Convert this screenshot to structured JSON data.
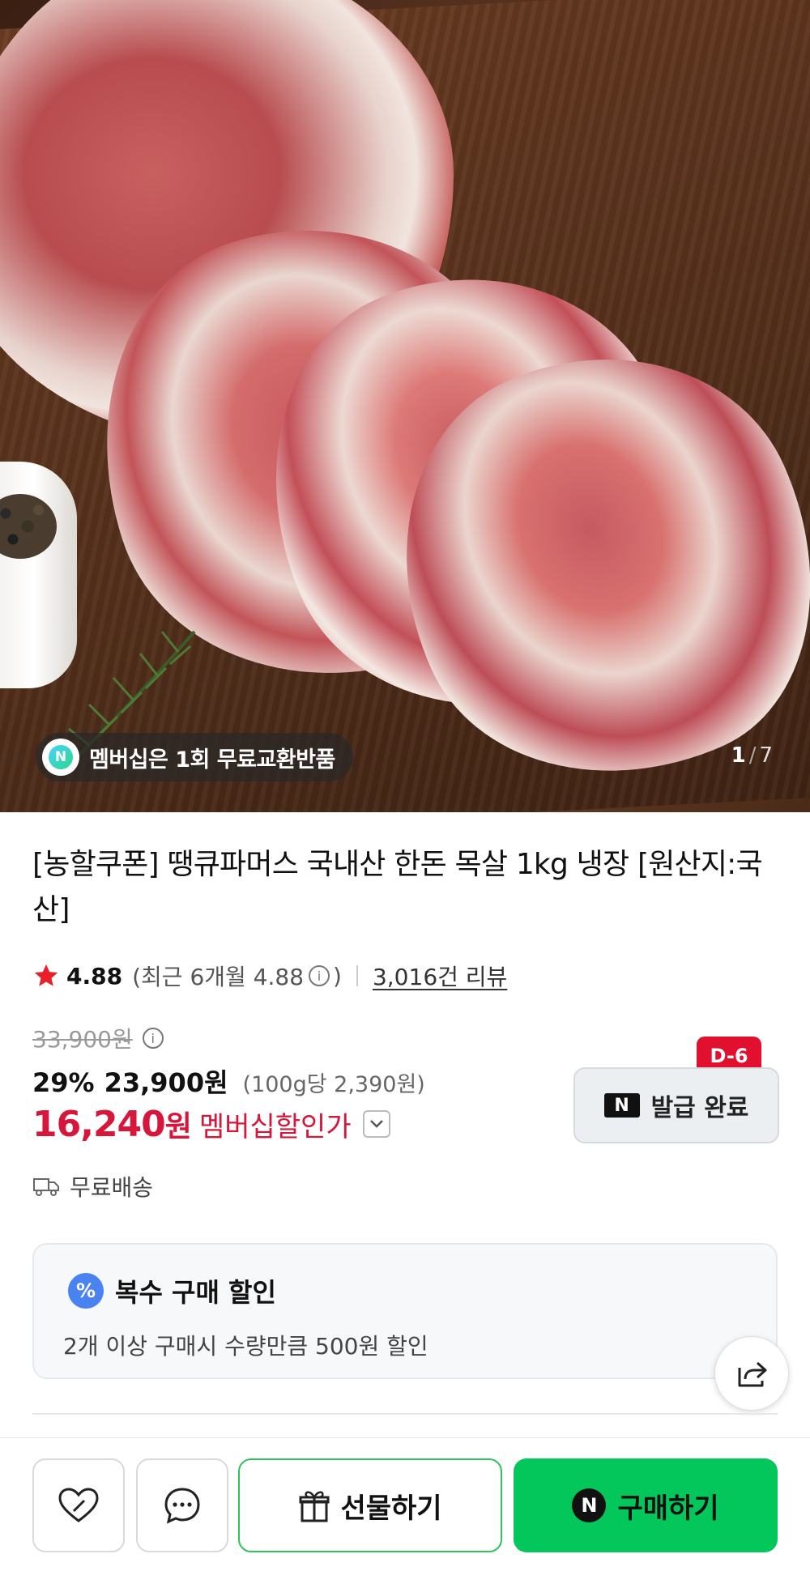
{
  "hero": {
    "badge_text": "멤버십은 1회 무료교환반품",
    "badge_icon_letter": "N",
    "counter_current": "1",
    "counter_sep": "/",
    "counter_total": "7"
  },
  "product": {
    "title": "[농할쿠폰] 땡큐파머스 국내산 한돈 목살 1kg 냉장 [원산지:국산]",
    "rating": "4.88",
    "rating_recent": "(최근 6개월 4.88",
    "rating_recent_close": ")",
    "review_count": "3,016건 리뷰"
  },
  "pricing": {
    "original_price": "33,900원",
    "discount_pct": "29%",
    "sale_price": "23,900원",
    "unit_price": "(100g당 2,390원)",
    "member_price_number": "16,240",
    "member_price_unit": "원",
    "member_label": "멤버십할인가"
  },
  "coupon": {
    "dday": "D-6",
    "logo_letter": "N",
    "label": "발급 완료"
  },
  "shipping": {
    "label": "무료배송"
  },
  "multi_discount": {
    "icon": "%",
    "title": "복수 구매 할인",
    "desc": "2개 이상 구매시 수량만큼 500원 할인"
  },
  "bottom_bar": {
    "gift_label": "선물하기",
    "buy_icon_letter": "N",
    "buy_label": "구매하기"
  },
  "colors": {
    "accent_red": "#d6163a",
    "buy_green": "#04c75b",
    "gift_border_green": "#2fc45f",
    "dday_red": "#e0102e"
  }
}
